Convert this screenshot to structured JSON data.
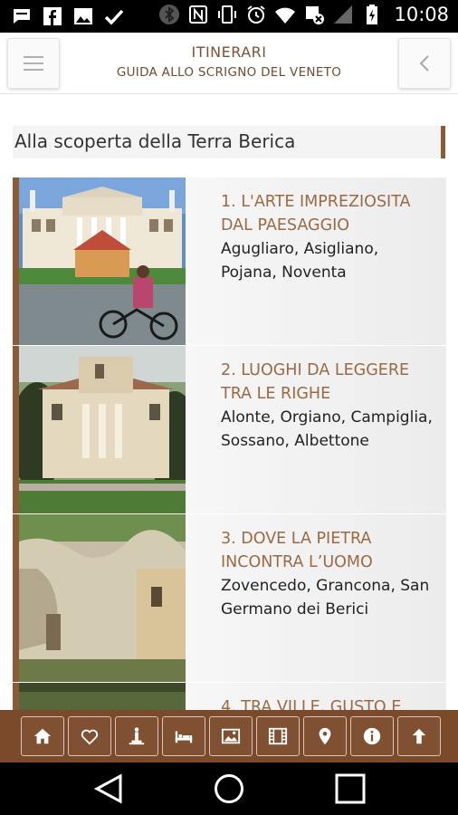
{
  "status_bar": {
    "time": "10:08",
    "left_icons": [
      "chat-icon",
      "facebook-icon",
      "image-icon",
      "check-icon"
    ],
    "right_icons": [
      "bluetooth-icon",
      "nfc-icon",
      "vibrate-icon",
      "alarm-icon",
      "wifi-icon",
      "data-off-icon",
      "signal-icon",
      "battery-charging-icon"
    ]
  },
  "header": {
    "title": "ITINERARI",
    "subtitle": "GUIDA ALLO SCRIGNO DEL VENETO",
    "menu_icon": "hamburger-icon",
    "back_icon": "chevron-left-icon"
  },
  "section_title": "Alla scoperta della Terra Berica",
  "itineraries": [
    {
      "title": "1. L'ARTE IMPREZIOSITA DAL PAESAGGIO",
      "places": "Agugliaro, Asigliano, Pojana, Noventa"
    },
    {
      "title": "2. LUOGHI DA LEGGERE TRA LE RIGHE",
      "places": "Alonte, Orgiano, Campiglia, Sossano, Albettone"
    },
    {
      "title": "3. DOVE LA PIETRA INCONTRA L’UOMO",
      "places": "Zovencedo, Grancona, San Germano dei Berici"
    },
    {
      "title": "4. TRA VILLE, GUSTO E",
      "places": ""
    }
  ],
  "toolbar": [
    "home-icon",
    "heart-icon",
    "monument-icon",
    "bed-icon",
    "picture-icon",
    "film-icon",
    "map-pin-icon",
    "info-icon",
    "arrow-up-icon"
  ],
  "colors": {
    "accent_brown": "#8b5a37",
    "toolbar_bg": "#7a4a2a",
    "heading_text": "#9b6a45"
  }
}
